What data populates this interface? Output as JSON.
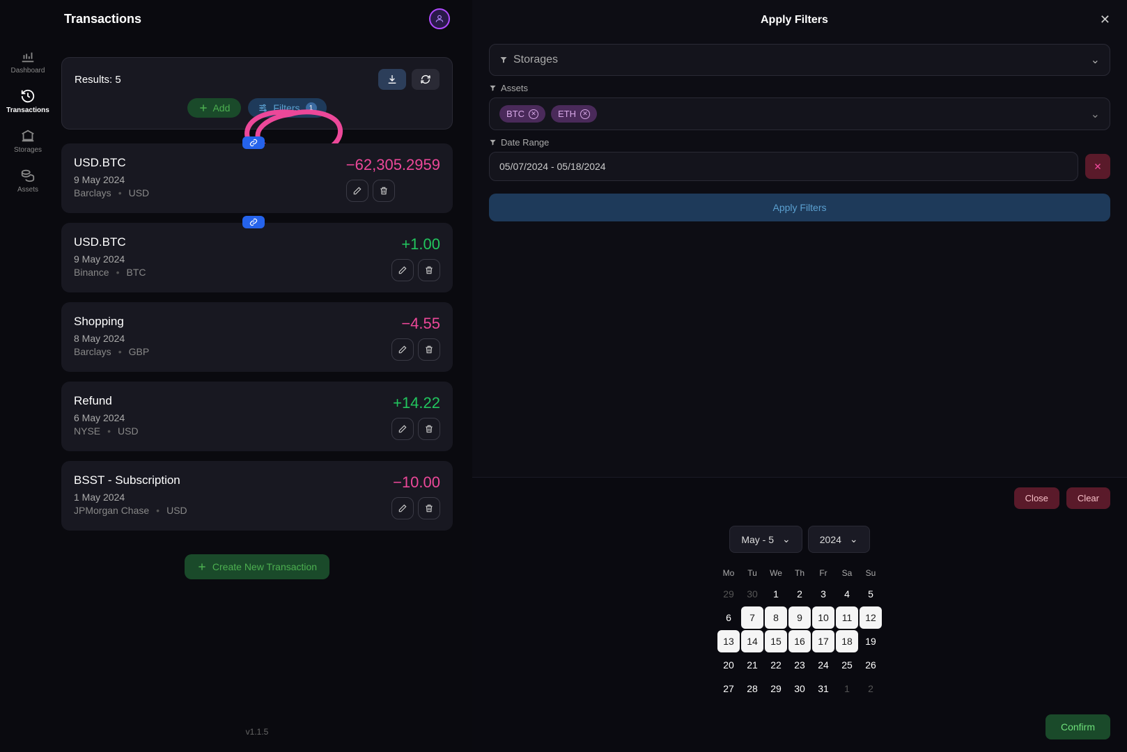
{
  "nav": {
    "items": [
      {
        "label": "Dashboard",
        "active": false
      },
      {
        "label": "Transactions",
        "active": true
      },
      {
        "label": "Storages",
        "active": false
      },
      {
        "label": "Assets",
        "active": false
      }
    ]
  },
  "page": {
    "title": "Transactions",
    "version": "v1.1.5"
  },
  "results": {
    "text": "Results: 5",
    "add": "Add",
    "filters": "Filters",
    "filter_count": "1"
  },
  "transactions": [
    {
      "title": "USD.BTC",
      "amount": "−62,305.2959",
      "sign": "neg",
      "date": "9 May 2024",
      "source": "Barclays",
      "cur": "USD",
      "link": true
    },
    {
      "title": "USD.BTC",
      "amount": "+1.00",
      "sign": "pos",
      "date": "9 May 2024",
      "source": "Binance",
      "cur": "BTC",
      "link": true
    },
    {
      "title": "Shopping",
      "amount": "−4.55",
      "sign": "neg",
      "date": "8 May 2024",
      "source": "Barclays",
      "cur": "GBP",
      "link": false
    },
    {
      "title": "Refund",
      "amount": "+14.22",
      "sign": "pos",
      "date": "6 May 2024",
      "source": "NYSE",
      "cur": "USD",
      "link": false
    },
    {
      "title": "BSST - Subscription",
      "amount": "−10.00",
      "sign": "neg",
      "date": "1 May 2024",
      "source": "JPMorgan Chase",
      "cur": "USD",
      "link": false
    }
  ],
  "create_label": "Create New Transaction",
  "panel": {
    "title": "Apply Filters",
    "storages_label": "Storages",
    "assets_label": "Assets",
    "asset_chips": [
      "BTC",
      "ETH"
    ],
    "daterange_label": "Date Range",
    "daterange_value": "05/07/2024 - 05/18/2024",
    "apply": "Apply Filters"
  },
  "calendar": {
    "close": "Close",
    "clear": "Clear",
    "month": "May - 5",
    "year": "2024",
    "confirm": "Confirm",
    "daynames": [
      "Mo",
      "Tu",
      "We",
      "Th",
      "Fr",
      "Sa",
      "Su"
    ],
    "days": [
      {
        "n": "29",
        "m": true
      },
      {
        "n": "30",
        "m": true
      },
      {
        "n": "1"
      },
      {
        "n": "2"
      },
      {
        "n": "3"
      },
      {
        "n": "4"
      },
      {
        "n": "5"
      },
      {
        "n": "6"
      },
      {
        "n": "7",
        "s": true
      },
      {
        "n": "8",
        "s": true
      },
      {
        "n": "9",
        "s": true
      },
      {
        "n": "10",
        "s": true
      },
      {
        "n": "11",
        "s": true
      },
      {
        "n": "12",
        "s": true
      },
      {
        "n": "13",
        "s": true
      },
      {
        "n": "14",
        "s": true
      },
      {
        "n": "15",
        "s": true
      },
      {
        "n": "16",
        "s": true
      },
      {
        "n": "17",
        "s": true
      },
      {
        "n": "18",
        "s": true
      },
      {
        "n": "19"
      },
      {
        "n": "20"
      },
      {
        "n": "21"
      },
      {
        "n": "22"
      },
      {
        "n": "23"
      },
      {
        "n": "24"
      },
      {
        "n": "25"
      },
      {
        "n": "26"
      },
      {
        "n": "27"
      },
      {
        "n": "28"
      },
      {
        "n": "29"
      },
      {
        "n": "30"
      },
      {
        "n": "31"
      },
      {
        "n": "1",
        "m": true
      },
      {
        "n": "2",
        "m": true
      }
    ]
  }
}
